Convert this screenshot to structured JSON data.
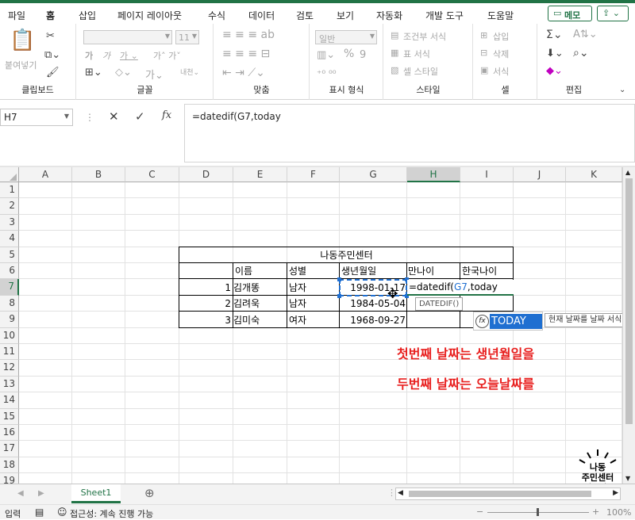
{
  "tabs": [
    "파일",
    "홈",
    "삽입",
    "페이지 레이아웃",
    "수식",
    "데이터",
    "검토",
    "보기",
    "자동화",
    "개발 도구",
    "도움말"
  ],
  "memo_label": "메모",
  "ribbon": {
    "clipboard": {
      "paste": "붙여넣기",
      "label": "클립보드"
    },
    "font": {
      "size": "11",
      "label": "글꼴"
    },
    "align": {
      "label": "맞춤"
    },
    "number": {
      "format": "일반",
      "percent": "%",
      "label": "표시 형식"
    },
    "styles": {
      "conditional": "조건부 서식",
      "table": "표 서식",
      "cell": "셀 스타일",
      "label": "스타일"
    },
    "cells": {
      "insert": "삽입",
      "delete": "삭제",
      "format": "서식",
      "label": "셀"
    },
    "edit": {
      "label": "편집"
    }
  },
  "formula_bar": {
    "name_box": "H7",
    "formula": "=datedif(G7,today"
  },
  "columns": [
    "A",
    "B",
    "C",
    "D",
    "E",
    "F",
    "G",
    "H",
    "I",
    "J",
    "K"
  ],
  "rows": [
    "1",
    "2",
    "3",
    "4",
    "5",
    "6",
    "7",
    "8",
    "9",
    "10",
    "11",
    "12",
    "13",
    "14",
    "15",
    "16",
    "17",
    "18",
    "19"
  ],
  "table": {
    "title": "나동주민센터",
    "headers": [
      "이름",
      "성별",
      "생년월일",
      "만나이",
      "한국나이"
    ],
    "records": [
      {
        "no": "1",
        "name": "김개똥",
        "gender": "남자",
        "birth": "1998-01-17"
      },
      {
        "no": "2",
        "name": "김려욱",
        "gender": "남자",
        "birth": "1984-05-04"
      },
      {
        "no": "3",
        "name": "김미숙",
        "gender": "여자",
        "birth": "1968-09-27"
      }
    ]
  },
  "editing": {
    "prefix": "=datedif(",
    "ref": "G7",
    "suffix": ",today"
  },
  "tooltip": "DATEDIF()",
  "autocomplete": {
    "item": "TODAY",
    "description": "현재 날짜를 날짜 서식"
  },
  "annotations": [
    "첫번째 날짜는 생년월일을",
    "두번째 날짜는 오늘날짜를"
  ],
  "watermark": [
    "나동",
    "주민센터"
  ],
  "sheet_tab": "Sheet1",
  "status": {
    "mode": "입력",
    "accessibility": "접근성: 계속 진행 가능",
    "zoom": "100%"
  },
  "colors": {
    "accent": "#217346",
    "selection": "#1f6fd1",
    "annotation": "#e8201f"
  }
}
